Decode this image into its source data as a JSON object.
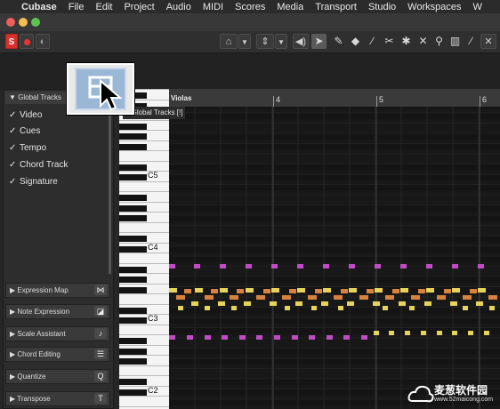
{
  "menubar": {
    "app": "Cubase",
    "items": [
      "File",
      "Edit",
      "Project",
      "Audio",
      "MIDI",
      "Scores",
      "Media",
      "Transport",
      "Studio",
      "Workspaces",
      "W"
    ]
  },
  "toolbar": {
    "s_label": "S",
    "tools": [
      "select-icon",
      "pencil-icon",
      "eraser-icon",
      "split-icon",
      "glue-icon",
      "mute-icon",
      "zoom-icon",
      "line-icon",
      "draw-icon"
    ]
  },
  "global_tracks": {
    "header": "Global Tracks",
    "items": [
      {
        "label": "Video",
        "checked": true
      },
      {
        "label": "Cues",
        "checked": true
      },
      {
        "label": "Tempo",
        "checked": true
      },
      {
        "label": "Chord Track",
        "checked": true
      },
      {
        "label": "Signature",
        "checked": true
      }
    ]
  },
  "sections": [
    {
      "label": "Expression Map",
      "icon": "⋈"
    },
    {
      "label": "Note Expression",
      "icon": "◪"
    },
    {
      "label": "Scale Assistant",
      "icon": "♪"
    },
    {
      "label": "Chord Editing",
      "icon": "☰"
    },
    {
      "label": "Quantize",
      "icon": "Q"
    },
    {
      "label": "Transpose",
      "icon": "T"
    }
  ],
  "ruler": {
    "track_name": "Violas",
    "bars": [
      "4",
      "5",
      "6"
    ]
  },
  "keyboard": {
    "labels": [
      "C5",
      "C4",
      "C3",
      "C2"
    ]
  },
  "tooltip": {
    "text": "e Global Tracks [!]"
  },
  "watermark": {
    "text": "麦葱软件园",
    "url_text": "www.52maicong.com"
  },
  "colors": {
    "magenta": "#c04bc4",
    "yellow": "#e6d45a",
    "orange": "#d7823f",
    "record_red": "#d8312c"
  }
}
